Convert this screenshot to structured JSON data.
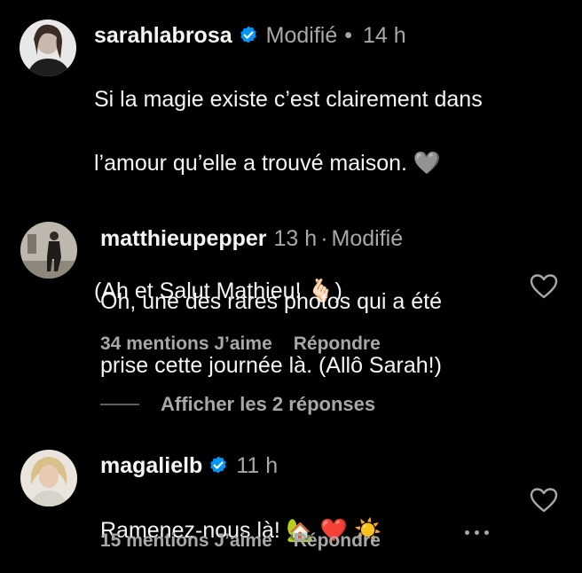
{
  "comments": [
    {
      "username": "sarahlabrosa",
      "verified": true,
      "edited": "Modifié",
      "separator": "•",
      "time": "14 h",
      "line1": "Si la magie existe c’est clairement dans",
      "line2": "l’amour qu’elle a trouvé maison. 🩶",
      "line3": "(Ah et Salut Mathieu! 🫰🏻)"
    },
    {
      "username": "matthieupepper",
      "time": "13 h",
      "separator": "·",
      "edited": "Modifié",
      "line1": "Oh, une des rares photos qui a été",
      "line2": "prise cette journée là. (Allô Sarah!)",
      "likes": "34 mentions J’aime",
      "reply": "Répondre",
      "view_replies": "Afficher les 2 réponses"
    },
    {
      "username": "magalielb",
      "verified": true,
      "time": "11 h",
      "line1": "Ramenez-nous là! 🏡 ❤️ ☀️",
      "likes": "15 mentions J’aime",
      "reply": "Répondre"
    }
  ],
  "icons": {
    "verified": "verified-badge-icon",
    "heart": "heart-outline-icon",
    "more": "more-options-icon"
  },
  "colors": {
    "background": "#000000",
    "primary_text": "#f5f5f5",
    "secondary_text": "#a8a8a8",
    "verified_blue": "#0095f6"
  }
}
